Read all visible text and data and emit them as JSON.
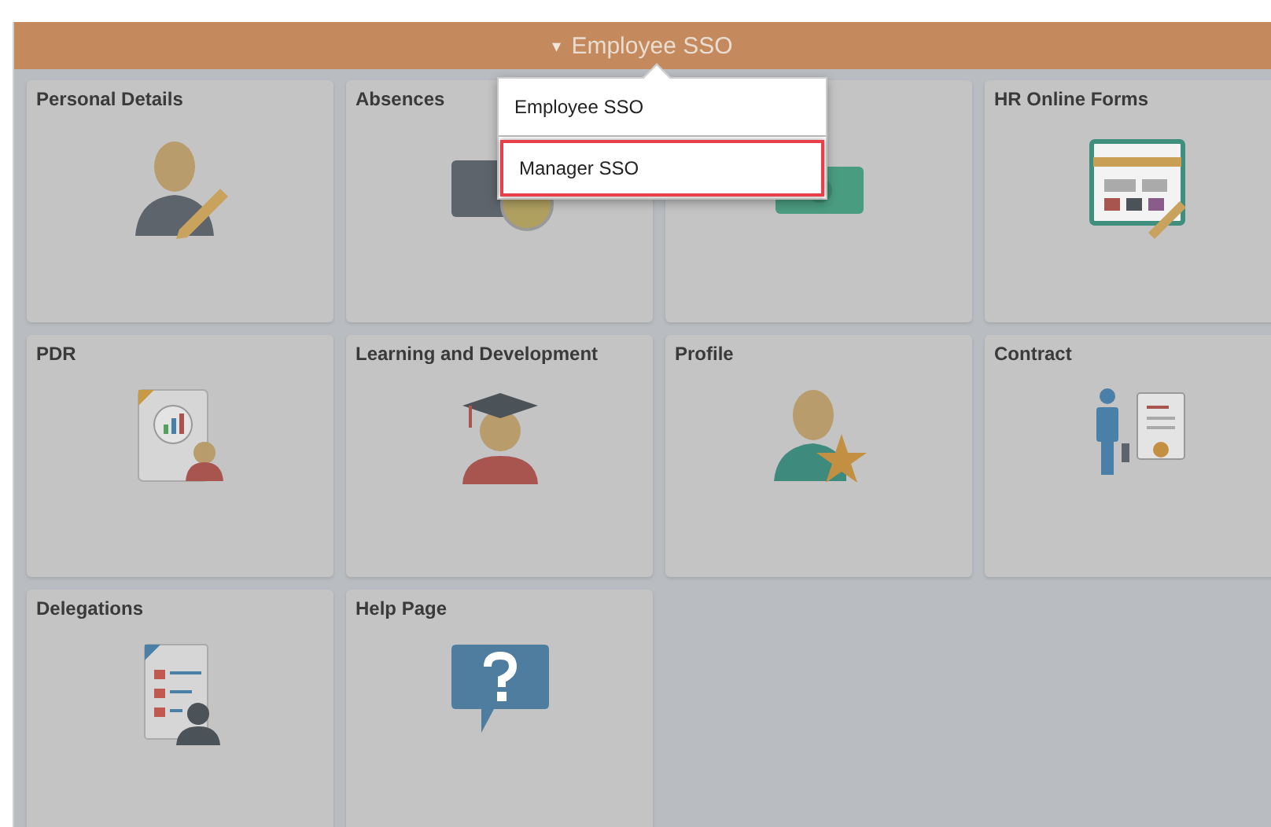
{
  "header": {
    "caret": "▾",
    "title": "Employee SSO"
  },
  "menu": {
    "items": [
      {
        "label": "Employee SSO",
        "selected": false
      },
      {
        "label": "Manager SSO",
        "selected": true
      }
    ]
  },
  "tiles": [
    {
      "title": "Personal Details",
      "covered": false
    },
    {
      "title": "Absences",
      "covered": false
    },
    {
      "covered": true
    },
    {
      "title": "HR Online Forms",
      "covered": false
    },
    {
      "title": "PDR",
      "covered": false
    },
    {
      "title": "Learning and Development",
      "covered": false
    },
    {
      "title": "Profile",
      "covered": false
    },
    {
      "title": "Contract",
      "covered": false
    },
    {
      "title": "Delegations",
      "covered": false
    },
    {
      "title": "Help Page",
      "covered": false
    }
  ]
}
